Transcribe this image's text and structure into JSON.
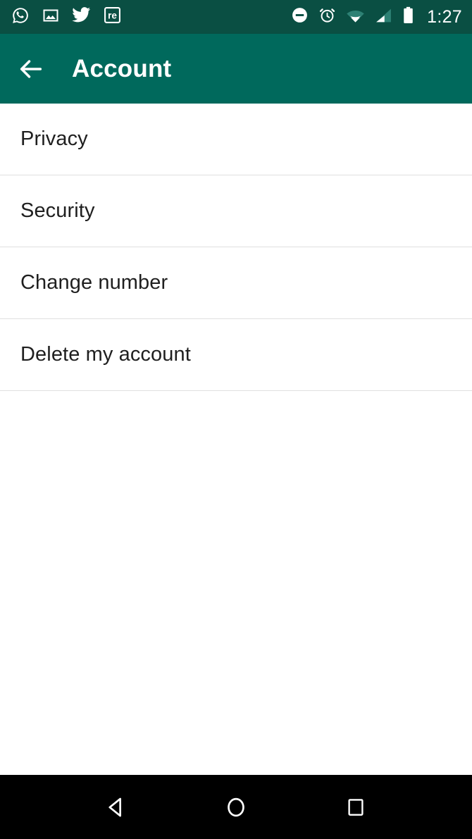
{
  "status_bar": {
    "background": "#0a4f43",
    "time": "1:27",
    "left_icons": [
      {
        "name": "whatsapp-icon",
        "label": "WhatsApp"
      },
      {
        "name": "photo-icon",
        "label": "Screenshot"
      },
      {
        "name": "twitter-icon",
        "label": "Twitter"
      },
      {
        "name": "re-badge-icon",
        "label": "re"
      }
    ],
    "right_icons": [
      {
        "name": "do-not-disturb-icon",
        "label": "Do not disturb"
      },
      {
        "name": "alarm-icon",
        "label": "Alarm set"
      },
      {
        "name": "wifi-icon",
        "label": "Wi-Fi"
      },
      {
        "name": "cellular-signal-icon",
        "label": "Cellular signal"
      },
      {
        "name": "battery-icon",
        "label": "Battery"
      }
    ]
  },
  "app_bar": {
    "background": "#00695c",
    "title": "Account",
    "back_icon": "arrow-left-icon"
  },
  "settings": {
    "items": [
      {
        "label": "Privacy"
      },
      {
        "label": "Security"
      },
      {
        "label": "Change number"
      },
      {
        "label": "Delete my account"
      }
    ]
  },
  "nav_bar": {
    "background": "#000000",
    "buttons": [
      {
        "name": "back",
        "icon": "triangle-left-icon",
        "label": "Back"
      },
      {
        "name": "home",
        "icon": "circle-icon",
        "label": "Home"
      },
      {
        "name": "recents",
        "icon": "square-icon",
        "label": "Recent apps"
      }
    ]
  }
}
